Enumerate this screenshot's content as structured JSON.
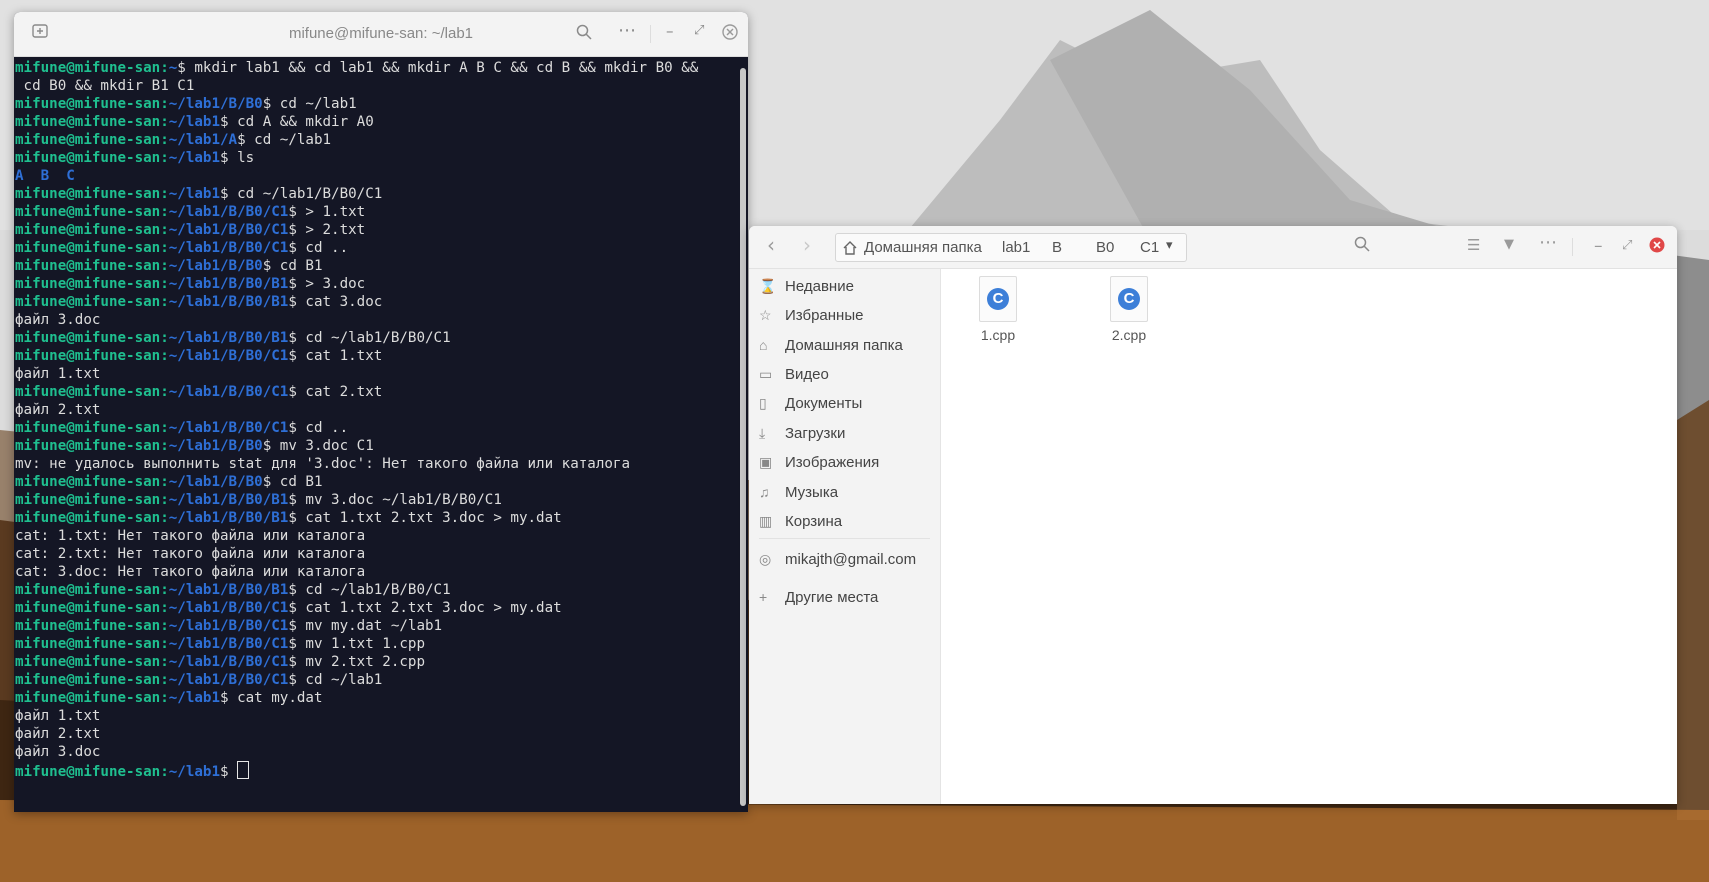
{
  "terminal": {
    "title": "mifune@mifune-san: ~/lab1",
    "lines": [
      [
        {
          "t": "mifune@mifune-san:",
          "c": "user"
        },
        {
          "t": "~",
          "c": "path"
        },
        {
          "t": "$ mkdir lab1 && cd lab1 && mkdir A B C && cd B && mkdir B0 &&",
          "c": ""
        }
      ],
      [
        {
          "t": " cd B0 && mkdir B1 C1",
          "c": ""
        }
      ],
      [
        {
          "t": "mifune@mifune-san:",
          "c": "user"
        },
        {
          "t": "~/lab1/B/B0",
          "c": "path"
        },
        {
          "t": "$ cd ~/lab1",
          "c": ""
        }
      ],
      [
        {
          "t": "mifune@mifune-san:",
          "c": "user"
        },
        {
          "t": "~/lab1",
          "c": "path"
        },
        {
          "t": "$ cd A && mkdir A0",
          "c": ""
        }
      ],
      [
        {
          "t": "mifune@mifune-san:",
          "c": "user"
        },
        {
          "t": "~/lab1/A",
          "c": "path"
        },
        {
          "t": "$ cd ~/lab1",
          "c": ""
        }
      ],
      [
        {
          "t": "mifune@mifune-san:",
          "c": "user"
        },
        {
          "t": "~/lab1",
          "c": "path"
        },
        {
          "t": "$ ls",
          "c": ""
        }
      ],
      [
        {
          "t": "A  B  C",
          "c": "dirlist"
        }
      ],
      [
        {
          "t": "mifune@mifune-san:",
          "c": "user"
        },
        {
          "t": "~/lab1",
          "c": "path"
        },
        {
          "t": "$ cd ~/lab1/B/B0/C1",
          "c": ""
        }
      ],
      [
        {
          "t": "mifune@mifune-san:",
          "c": "user"
        },
        {
          "t": "~/lab1/B/B0/C1",
          "c": "path"
        },
        {
          "t": "$ > 1.txt",
          "c": ""
        }
      ],
      [
        {
          "t": "mifune@mifune-san:",
          "c": "user"
        },
        {
          "t": "~/lab1/B/B0/C1",
          "c": "path"
        },
        {
          "t": "$ > 2.txt",
          "c": ""
        }
      ],
      [
        {
          "t": "mifune@mifune-san:",
          "c": "user"
        },
        {
          "t": "~/lab1/B/B0/C1",
          "c": "path"
        },
        {
          "t": "$ cd ..",
          "c": ""
        }
      ],
      [
        {
          "t": "mifune@mifune-san:",
          "c": "user"
        },
        {
          "t": "~/lab1/B/B0",
          "c": "path"
        },
        {
          "t": "$ cd B1",
          "c": ""
        }
      ],
      [
        {
          "t": "mifune@mifune-san:",
          "c": "user"
        },
        {
          "t": "~/lab1/B/B0/B1",
          "c": "path"
        },
        {
          "t": "$ > 3.doc",
          "c": ""
        }
      ],
      [
        {
          "t": "mifune@mifune-san:",
          "c": "user"
        },
        {
          "t": "~/lab1/B/B0/B1",
          "c": "path"
        },
        {
          "t": "$ cat 3.doc",
          "c": ""
        }
      ],
      [
        {
          "t": "файл 3.doc",
          "c": ""
        }
      ],
      [
        {
          "t": "mifune@mifune-san:",
          "c": "user"
        },
        {
          "t": "~/lab1/B/B0/B1",
          "c": "path"
        },
        {
          "t": "$ cd ~/lab1/B/B0/C1",
          "c": ""
        }
      ],
      [
        {
          "t": "mifune@mifune-san:",
          "c": "user"
        },
        {
          "t": "~/lab1/B/B0/C1",
          "c": "path"
        },
        {
          "t": "$ cat 1.txt",
          "c": ""
        }
      ],
      [
        {
          "t": "файл 1.txt",
          "c": ""
        }
      ],
      [
        {
          "t": "mifune@mifune-san:",
          "c": "user"
        },
        {
          "t": "~/lab1/B/B0/C1",
          "c": "path"
        },
        {
          "t": "$ cat 2.txt",
          "c": ""
        }
      ],
      [
        {
          "t": "файл 2.txt",
          "c": ""
        }
      ],
      [
        {
          "t": "mifune@mifune-san:",
          "c": "user"
        },
        {
          "t": "~/lab1/B/B0/C1",
          "c": "path"
        },
        {
          "t": "$ cd ..",
          "c": ""
        }
      ],
      [
        {
          "t": "mifune@mifune-san:",
          "c": "user"
        },
        {
          "t": "~/lab1/B/B0",
          "c": "path"
        },
        {
          "t": "$ mv 3.doc C1",
          "c": ""
        }
      ],
      [
        {
          "t": "mv: не удалось выполнить stat для '3.doc': Нет такого файла или каталога",
          "c": ""
        }
      ],
      [
        {
          "t": "mifune@mifune-san:",
          "c": "user"
        },
        {
          "t": "~/lab1/B/B0",
          "c": "path"
        },
        {
          "t": "$ cd B1",
          "c": ""
        }
      ],
      [
        {
          "t": "mifune@mifune-san:",
          "c": "user"
        },
        {
          "t": "~/lab1/B/B0/B1",
          "c": "path"
        },
        {
          "t": "$ mv 3.doc ~/lab1/B/B0/C1",
          "c": ""
        }
      ],
      [
        {
          "t": "mifune@mifune-san:",
          "c": "user"
        },
        {
          "t": "~/lab1/B/B0/B1",
          "c": "path"
        },
        {
          "t": "$ cat 1.txt 2.txt 3.doc > my.dat",
          "c": ""
        }
      ],
      [
        {
          "t": "cat: 1.txt: Нет такого файла или каталога",
          "c": ""
        }
      ],
      [
        {
          "t": "cat: 2.txt: Нет такого файла или каталога",
          "c": ""
        }
      ],
      [
        {
          "t": "cat: 3.doc: Нет такого файла или каталога",
          "c": ""
        }
      ],
      [
        {
          "t": "mifune@mifune-san:",
          "c": "user"
        },
        {
          "t": "~/lab1/B/B0/B1",
          "c": "path"
        },
        {
          "t": "$ cd ~/lab1/B/B0/C1",
          "c": ""
        }
      ],
      [
        {
          "t": "mifune@mifune-san:",
          "c": "user"
        },
        {
          "t": "~/lab1/B/B0/C1",
          "c": "path"
        },
        {
          "t": "$ cat 1.txt 2.txt 3.doc > my.dat",
          "c": ""
        }
      ],
      [
        {
          "t": "mifune@mifune-san:",
          "c": "user"
        },
        {
          "t": "~/lab1/B/B0/C1",
          "c": "path"
        },
        {
          "t": "$ mv my.dat ~/lab1",
          "c": ""
        }
      ],
      [
        {
          "t": "mifune@mifune-san:",
          "c": "user"
        },
        {
          "t": "~/lab1/B/B0/C1",
          "c": "path"
        },
        {
          "t": "$ mv 1.txt 1.cpp",
          "c": ""
        }
      ],
      [
        {
          "t": "mifune@mifune-san:",
          "c": "user"
        },
        {
          "t": "~/lab1/B/B0/C1",
          "c": "path"
        },
        {
          "t": "$ mv 2.txt 2.cpp",
          "c": ""
        }
      ],
      [
        {
          "t": "mifune@mifune-san:",
          "c": "user"
        },
        {
          "t": "~/lab1/B/B0/C1",
          "c": "path"
        },
        {
          "t": "$ cd ~/lab1",
          "c": ""
        }
      ],
      [
        {
          "t": "mifune@mifune-san:",
          "c": "user"
        },
        {
          "t": "~/lab1",
          "c": "path"
        },
        {
          "t": "$ cat my.dat",
          "c": ""
        }
      ],
      [
        {
          "t": "файл 1.txt",
          "c": ""
        }
      ],
      [
        {
          "t": "файл 2.txt",
          "c": ""
        }
      ],
      [
        {
          "t": "файл 3.doc",
          "c": ""
        }
      ],
      [
        {
          "t": "mifune@mifune-san:",
          "c": "user"
        },
        {
          "t": "~/lab1",
          "c": "path"
        },
        {
          "t": "$ ",
          "c": ""
        },
        {
          "t": "",
          "c": "cursor"
        }
      ]
    ],
    "icons": {
      "new_tab": "new-tab-icon",
      "search": "search-icon",
      "menu": "more-icon",
      "minimize": "minimize-icon",
      "maximize": "maximize-icon",
      "close": "close-icon"
    }
  },
  "file_manager": {
    "breadcrumb": [
      "Домашняя папка",
      "lab1",
      "B",
      "B0",
      "C1"
    ],
    "sidebar": [
      {
        "label": "Недавние",
        "icon": "hourglass-icon"
      },
      {
        "label": "Избранные",
        "icon": "star-icon"
      },
      {
        "label": "Домашняя папка",
        "icon": "home-icon"
      },
      {
        "label": "Видео",
        "icon": "video-icon"
      },
      {
        "label": "Документы",
        "icon": "document-icon"
      },
      {
        "label": "Загрузки",
        "icon": "download-icon"
      },
      {
        "label": "Изображения",
        "icon": "image-icon"
      },
      {
        "label": "Музыка",
        "icon": "music-icon"
      },
      {
        "label": "Корзина",
        "icon": "trash-icon"
      },
      {
        "label": "mikajth@gmail.com",
        "icon": "account-icon"
      },
      {
        "label": "Другие места",
        "icon": "plus-icon"
      }
    ],
    "files": [
      {
        "name": "1.cpp",
        "icon": "cpp-file-icon",
        "glyph": "C"
      },
      {
        "name": "2.cpp",
        "icon": "cpp-file-icon",
        "glyph": "C"
      }
    ]
  },
  "colors": {
    "terminal_bg": "#141625",
    "prompt_user": "#1fbf8f",
    "prompt_path": "#2e6fd6",
    "close_red": "#e04848",
    "cpp_blue": "#3d7fd8"
  }
}
